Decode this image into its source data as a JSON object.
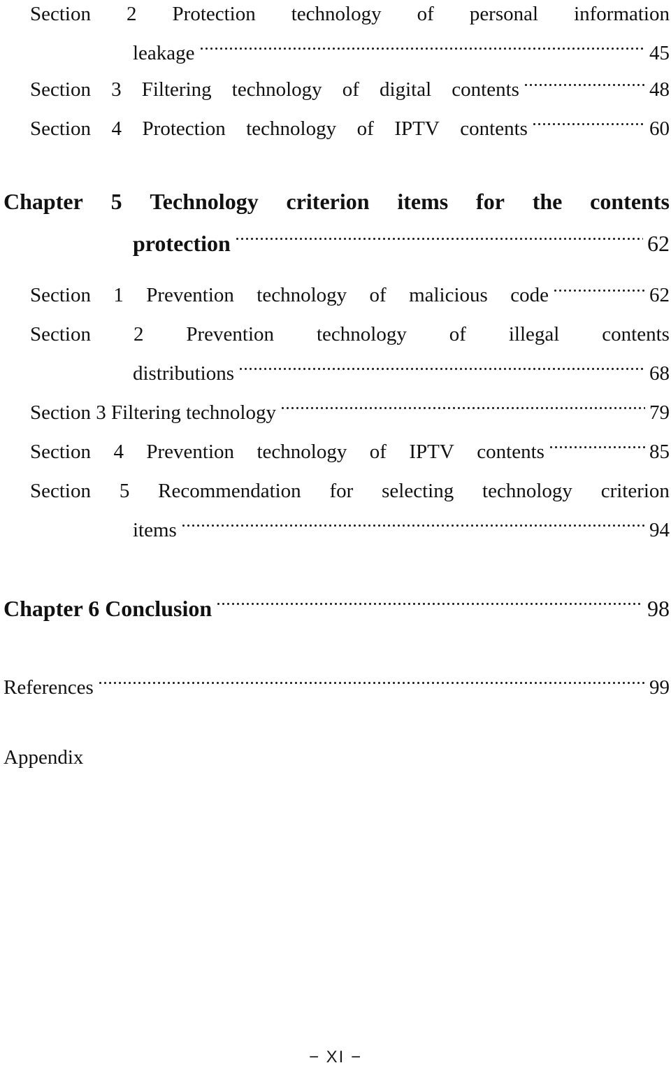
{
  "document": {
    "kind": "table-of-contents",
    "footer_label": "− XI −"
  },
  "entries": [
    {
      "id": "ch4-sec2",
      "type": "section",
      "label": "Section 2 Protection technology of personal information leakage",
      "line1_words": [
        "Section",
        "2",
        "Protection",
        "technology",
        "of",
        "personal",
        "information"
      ],
      "line2_text": "leakage",
      "page": "45"
    },
    {
      "id": "ch4-sec3",
      "type": "section",
      "label": "Section 3 Filtering technology of digital contents",
      "line1_words": [
        "Section",
        "3",
        "Filtering",
        "technology",
        "of",
        "digital",
        "contents"
      ],
      "page": "48"
    },
    {
      "id": "ch4-sec4",
      "type": "section",
      "label": "Section 4 Protection technology of  IPTV contents",
      "line1_words": [
        "Section",
        "4",
        "Protection",
        "technology",
        "of",
        "IPTV",
        "contents"
      ],
      "page": "60"
    },
    {
      "id": "ch5",
      "type": "chapter",
      "label": "Chapter 5 Technology criterion items for the contents protection",
      "line1_words": [
        "Chapter",
        "5",
        "Technology",
        "criterion",
        "items",
        "for",
        "the",
        "contents"
      ],
      "line2_text": "protection",
      "page": "62"
    },
    {
      "id": "ch5-sec1",
      "type": "section",
      "label": "Section 1 Prevention technology of malicious code",
      "line1_words": [
        "Section",
        "1",
        "Prevention",
        "technology",
        "of",
        "malicious",
        "code"
      ],
      "page": "62"
    },
    {
      "id": "ch5-sec2",
      "type": "section",
      "label": "Section 2 Prevention technology of illegal contents distributions",
      "line1_words": [
        "Section",
        "2",
        "Prevention",
        "technology",
        "of",
        "illegal",
        "contents"
      ],
      "line2_text": "distributions",
      "page": "68"
    },
    {
      "id": "ch5-sec3",
      "type": "section",
      "label": "Section 3 Filtering technology",
      "line1_text": "Section 3 Filtering technology",
      "page": "79"
    },
    {
      "id": "ch5-sec4",
      "type": "section",
      "label": "Section 4 Prevention technology of IPTV contents",
      "line1_words": [
        "Section",
        "4",
        "Prevention",
        "technology",
        "of",
        "IPTV",
        "contents"
      ],
      "page": "85"
    },
    {
      "id": "ch5-sec5",
      "type": "section",
      "label": "Section 5 Recommendation for selecting technology criterion items",
      "line1_words": [
        "Section",
        "5",
        "Recommendation",
        "for",
        "selecting",
        "technology",
        "criterion"
      ],
      "line2_text": "items",
      "page": "94"
    },
    {
      "id": "ch6",
      "type": "chapter",
      "label": "Chapter 6 Conclusion",
      "line1_text": "Chapter 6 Conclusion",
      "page": "98"
    },
    {
      "id": "references",
      "type": "plain",
      "label": "References",
      "line1_text": "References",
      "page": "99"
    },
    {
      "id": "appendix",
      "type": "plain",
      "label": "Appendix",
      "line1_text": "Appendix",
      "page": ""
    }
  ]
}
